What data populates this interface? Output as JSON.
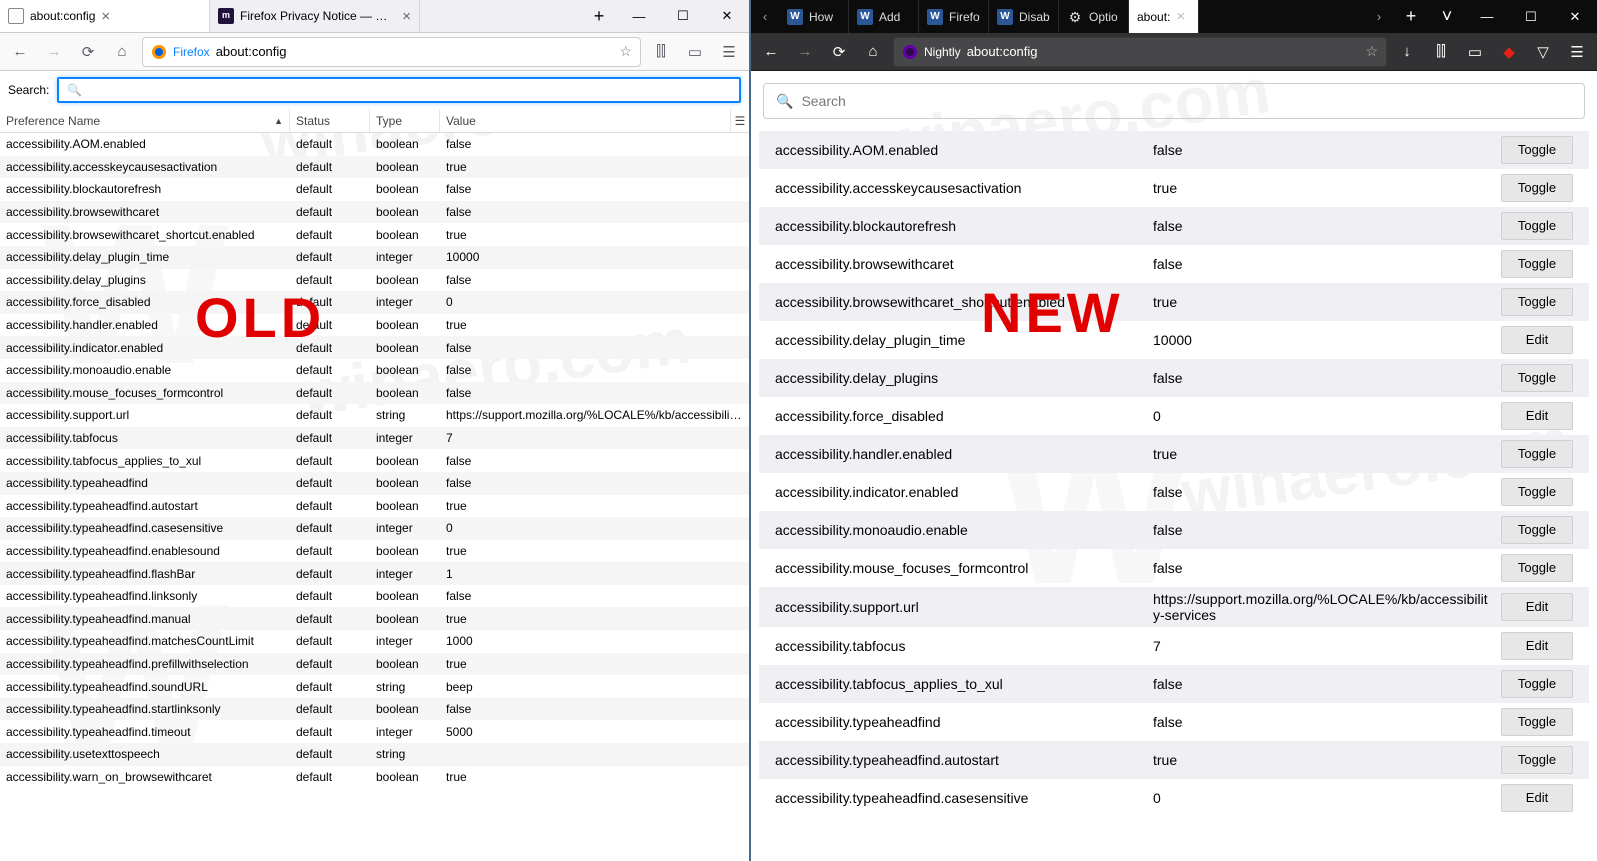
{
  "overlays": {
    "old_label": "OLD",
    "new_label": "NEW"
  },
  "left": {
    "tabs": [
      {
        "label": "about:config",
        "active": true,
        "favicon": "generic",
        "close": "×"
      },
      {
        "label": "Firefox Privacy Notice — Mozi",
        "active": false,
        "favicon": "moz",
        "close": "×"
      }
    ],
    "plus": "+",
    "win_min": "—",
    "win_max": "☐",
    "win_close": "✕",
    "toolbar": {
      "back": "←",
      "forward": "→",
      "reload": "⟳",
      "home": "⌂",
      "identity_text": "Firefox",
      "url": "about:config",
      "star": "☆",
      "library": "⫿⫿",
      "reader": "▭",
      "menu": "☰"
    },
    "search_label": "Search:",
    "table_header": {
      "name": "Preference Name",
      "status": "Status",
      "type": "Type",
      "value": "Value",
      "sort_indicator": "▲",
      "config_col": "☰"
    },
    "rows": [
      [
        "accessibility.AOM.enabled",
        "default",
        "boolean",
        "false"
      ],
      [
        "accessibility.accesskeycausesactivation",
        "default",
        "boolean",
        "true"
      ],
      [
        "accessibility.blockautorefresh",
        "default",
        "boolean",
        "false"
      ],
      [
        "accessibility.browsewithcaret",
        "default",
        "boolean",
        "false"
      ],
      [
        "accessibility.browsewithcaret_shortcut.enabled",
        "default",
        "boolean",
        "true"
      ],
      [
        "accessibility.delay_plugin_time",
        "default",
        "integer",
        "10000"
      ],
      [
        "accessibility.delay_plugins",
        "default",
        "boolean",
        "false"
      ],
      [
        "accessibility.force_disabled",
        "default",
        "integer",
        "0"
      ],
      [
        "accessibility.handler.enabled",
        "default",
        "boolean",
        "true"
      ],
      [
        "accessibility.indicator.enabled",
        "default",
        "boolean",
        "false"
      ],
      [
        "accessibility.monoaudio.enable",
        "default",
        "boolean",
        "false"
      ],
      [
        "accessibility.mouse_focuses_formcontrol",
        "default",
        "boolean",
        "false"
      ],
      [
        "accessibility.support.url",
        "default",
        "string",
        "https://support.mozilla.org/%LOCALE%/kb/accessibility..."
      ],
      [
        "accessibility.tabfocus",
        "default",
        "integer",
        "7"
      ],
      [
        "accessibility.tabfocus_applies_to_xul",
        "default",
        "boolean",
        "false"
      ],
      [
        "accessibility.typeaheadfind",
        "default",
        "boolean",
        "false"
      ],
      [
        "accessibility.typeaheadfind.autostart",
        "default",
        "boolean",
        "true"
      ],
      [
        "accessibility.typeaheadfind.casesensitive",
        "default",
        "integer",
        "0"
      ],
      [
        "accessibility.typeaheadfind.enablesound",
        "default",
        "boolean",
        "true"
      ],
      [
        "accessibility.typeaheadfind.flashBar",
        "default",
        "integer",
        "1"
      ],
      [
        "accessibility.typeaheadfind.linksonly",
        "default",
        "boolean",
        "false"
      ],
      [
        "accessibility.typeaheadfind.manual",
        "default",
        "boolean",
        "true"
      ],
      [
        "accessibility.typeaheadfind.matchesCountLimit",
        "default",
        "integer",
        "1000"
      ],
      [
        "accessibility.typeaheadfind.prefillwithselection",
        "default",
        "boolean",
        "true"
      ],
      [
        "accessibility.typeaheadfind.soundURL",
        "default",
        "string",
        "beep"
      ],
      [
        "accessibility.typeaheadfind.startlinksonly",
        "default",
        "boolean",
        "false"
      ],
      [
        "accessibility.typeaheadfind.timeout",
        "default",
        "integer",
        "5000"
      ],
      [
        "accessibility.usetexttospeech",
        "default",
        "string",
        ""
      ],
      [
        "accessibility.warn_on_browsewithcaret",
        "default",
        "boolean",
        "true"
      ]
    ]
  },
  "right": {
    "tabscroll_left": "‹",
    "tabscroll_right": "›",
    "tabs": [
      {
        "label": "How",
        "favicon": "w"
      },
      {
        "label": "Add",
        "favicon": "w"
      },
      {
        "label": "Firefo",
        "favicon": "w"
      },
      {
        "label": "Disab",
        "favicon": "w"
      },
      {
        "label": "Optio",
        "favicon": "gear"
      },
      {
        "label": "about:",
        "favicon": "",
        "active": true,
        "close": "×"
      }
    ],
    "plus": "+",
    "list": "˅",
    "win_min": "—",
    "win_max": "☐",
    "win_close": "✕",
    "toolbar": {
      "back": "←",
      "forward": "→",
      "reload": "⟳",
      "home": "⌂",
      "identity_text": "Nightly",
      "url": "about:config",
      "star": "☆",
      "download": "↓",
      "library": "⫿⫿",
      "reader": "▭",
      "ublock": "◆",
      "shield": "▽",
      "menu": "☰"
    },
    "search_placeholder": "Search",
    "rows": [
      [
        "accessibility.AOM.enabled",
        "false",
        "Toggle"
      ],
      [
        "accessibility.accesskeycausesactivation",
        "true",
        "Toggle"
      ],
      [
        "accessibility.blockautorefresh",
        "false",
        "Toggle"
      ],
      [
        "accessibility.browsewithcaret",
        "false",
        "Toggle"
      ],
      [
        "accessibility.browsewithcaret_shortcut.enabled",
        "true",
        "Toggle"
      ],
      [
        "accessibility.delay_plugin_time",
        "10000",
        "Edit"
      ],
      [
        "accessibility.delay_plugins",
        "false",
        "Toggle"
      ],
      [
        "accessibility.force_disabled",
        "0",
        "Edit"
      ],
      [
        "accessibility.handler.enabled",
        "true",
        "Toggle"
      ],
      [
        "accessibility.indicator.enabled",
        "false",
        "Toggle"
      ],
      [
        "accessibility.monoaudio.enable",
        "false",
        "Toggle"
      ],
      [
        "accessibility.mouse_focuses_formcontrol",
        "false",
        "Toggle"
      ],
      [
        "accessibility.support.url",
        "https://support.mozilla.org/%LOCALE%/kb/accessibility-services",
        "Edit"
      ],
      [
        "accessibility.tabfocus",
        "7",
        "Edit"
      ],
      [
        "accessibility.tabfocus_applies_to_xul",
        "false",
        "Toggle"
      ],
      [
        "accessibility.typeaheadfind",
        "false",
        "Toggle"
      ],
      [
        "accessibility.typeaheadfind.autostart",
        "true",
        "Toggle"
      ],
      [
        "accessibility.typeaheadfind.casesensitive",
        "0",
        "Edit"
      ]
    ]
  }
}
